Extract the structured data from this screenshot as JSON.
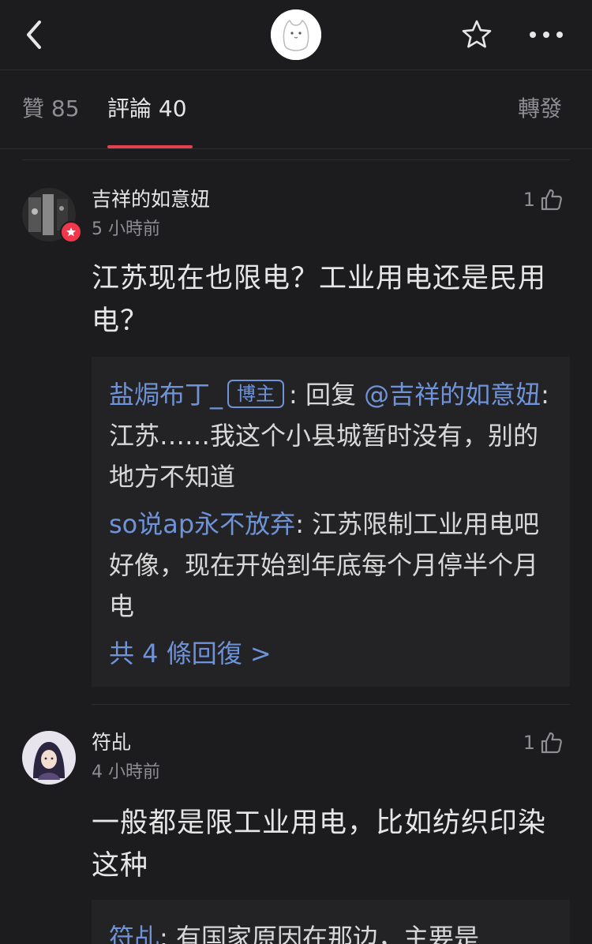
{
  "header": {
    "back_icon": "chevron-left-icon",
    "avatar_icon": "cat-avatar",
    "favorite_icon": "star-outline-icon",
    "more_icon": "ellipsis-icon"
  },
  "tabs": [
    {
      "label": "贊 85"
    },
    {
      "label": "評論 40"
    },
    {
      "label": "轉發"
    }
  ],
  "comments": [
    {
      "name": "吉祥的如意妞",
      "time": "5 小時前",
      "likes": "1",
      "text": "江苏现在也限电？工业用电还是民用电？",
      "replies": [
        {
          "author": "盐焗布丁_",
          "tag": "博主",
          "prefix": ": 回复 ",
          "mention": "@吉祥的如意妞",
          "body": ":江苏……我这个小县城暂时没有，别的地方不知道"
        },
        {
          "author": "so说ap永不放弃",
          "body": ": 江苏限制工业用电吧好像，现在开始到年底每个月停半个月电"
        }
      ],
      "more_replies": "共 4 條回復 >"
    },
    {
      "name": "符乩",
      "time": "4 小時前",
      "likes": "1",
      "text": "一般都是限工业用电，比如纺织印染这种",
      "replies": [
        {
          "author": "符乩",
          "body": ": 有国家原因在那边，主要是"
        }
      ]
    }
  ],
  "colors": {
    "accent": "#e5404e",
    "link": "#6f93d8",
    "background": "#1c1c1e"
  }
}
